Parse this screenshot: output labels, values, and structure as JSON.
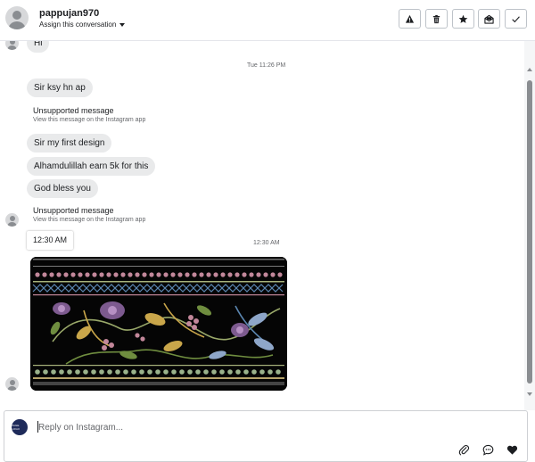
{
  "header": {
    "username": "pappujan970",
    "assign_label": "Assign this conversation",
    "actions": [
      "warning-icon",
      "trash-icon",
      "star-icon",
      "envelope-open-icon",
      "checkmark-icon"
    ]
  },
  "thread": {
    "messages": [
      {
        "text": "Hi"
      },
      {
        "text": "Sir ksy hn ap"
      },
      {
        "text": "Sir my first design"
      },
      {
        "text": "Alhamdulillah earn 5k for this"
      },
      {
        "text": "God bless you"
      }
    ],
    "timestamps": [
      "Tue 11:26 PM",
      "12:30 AM"
    ],
    "unsupported": [
      {
        "title": "Unsupported message",
        "subtitle": "View this message on the Instagram app"
      },
      {
        "title": "Unsupported message",
        "subtitle": "View this message on the Instagram app"
      }
    ],
    "time_card": "12:30 AM"
  },
  "composer": {
    "placeholder": "Reply on Instagram...",
    "page_logo_text": "PAGE LOGO",
    "icons": [
      "paperclip-icon",
      "chat-bubble-icon",
      "heart-icon"
    ]
  },
  "colors": {
    "bubble": "#e9eaeb",
    "text": "#1c1e21",
    "muted": "#65676b",
    "border": "#ced0d4"
  }
}
